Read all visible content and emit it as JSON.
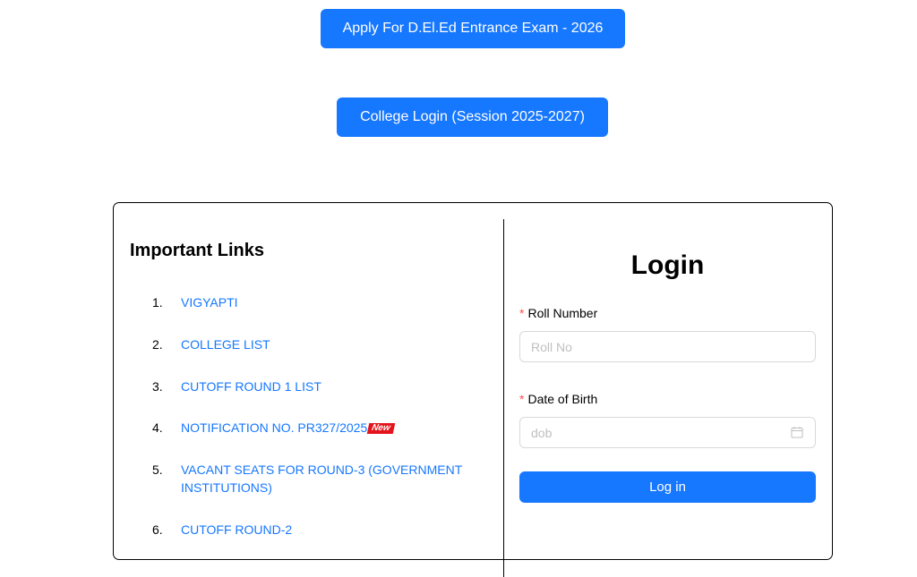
{
  "header": {
    "apply_button_label": "Apply For D.El.Ed Entrance Exam - 2026",
    "college_login_label": "College Login (Session 2025-2027)"
  },
  "important_links": {
    "title": "Important Links",
    "items": [
      {
        "number": "1.",
        "label": "VIGYAPTI"
      },
      {
        "number": "2.",
        "label": "COLLEGE LIST"
      },
      {
        "number": "3.",
        "label": "CUTOFF ROUND 1 LIST"
      },
      {
        "number": "4.",
        "label": "NOTIFICATION NO. PR327/2025",
        "badge": "New"
      },
      {
        "number": "5.",
        "label": "VACANT SEATS FOR ROUND-3 (GOVERNMENT INSTITUTIONS)"
      },
      {
        "number": "6.",
        "label": "CUTOFF ROUND-2"
      }
    ]
  },
  "login": {
    "title": "Login",
    "required_mark": "*",
    "roll_label": "Roll Number",
    "roll_placeholder": "Roll No",
    "dob_label": "Date of Birth",
    "dob_placeholder": "dob",
    "submit_label": "Log in"
  },
  "colors": {
    "primary": "#1677ff",
    "required": "#ff4d4f",
    "badge": "#e3141b"
  },
  "icons": {
    "dob_icon": "calendar-icon"
  }
}
